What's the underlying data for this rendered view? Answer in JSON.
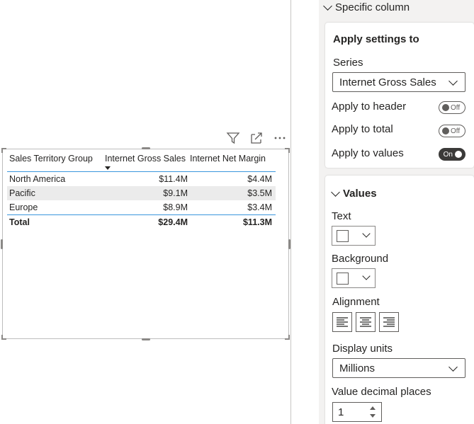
{
  "visual_header": {
    "icons": [
      "filter-icon",
      "focus-mode-icon",
      "more-options-icon"
    ]
  },
  "table": {
    "columns": [
      "Sales Territory Group",
      "Internet Gross Sales",
      "Internet Net Margin"
    ],
    "rows": [
      [
        "North America",
        "$11.4M",
        "$4.4M"
      ],
      [
        "Pacific",
        "$9.1M",
        "$3.5M"
      ],
      [
        "Europe",
        "$8.9M",
        "$3.4M"
      ]
    ],
    "total": [
      "Total",
      "$29.4M",
      "$11.3M"
    ],
    "sort_column": "Internet Gross Sales",
    "accent_color": "#3a96dd"
  },
  "pane": {
    "specific_column": {
      "title": "Specific column",
      "apply_settings_title": "Apply settings to",
      "series_label": "Series",
      "series_value": "Internet Gross Sales",
      "apply_header_label": "Apply to header",
      "apply_header_state": "Off",
      "apply_total_label": "Apply to total",
      "apply_total_state": "Off",
      "apply_values_label": "Apply to values",
      "apply_values_state": "On"
    },
    "values": {
      "title": "Values",
      "text_label": "Text",
      "background_label": "Background",
      "alignment_label": "Alignment",
      "alignment_options": [
        "left",
        "center",
        "right"
      ],
      "display_units_label": "Display units",
      "display_units_value": "Millions",
      "decimal_places_label": "Value decimal places",
      "decimal_places_value": "1"
    }
  }
}
